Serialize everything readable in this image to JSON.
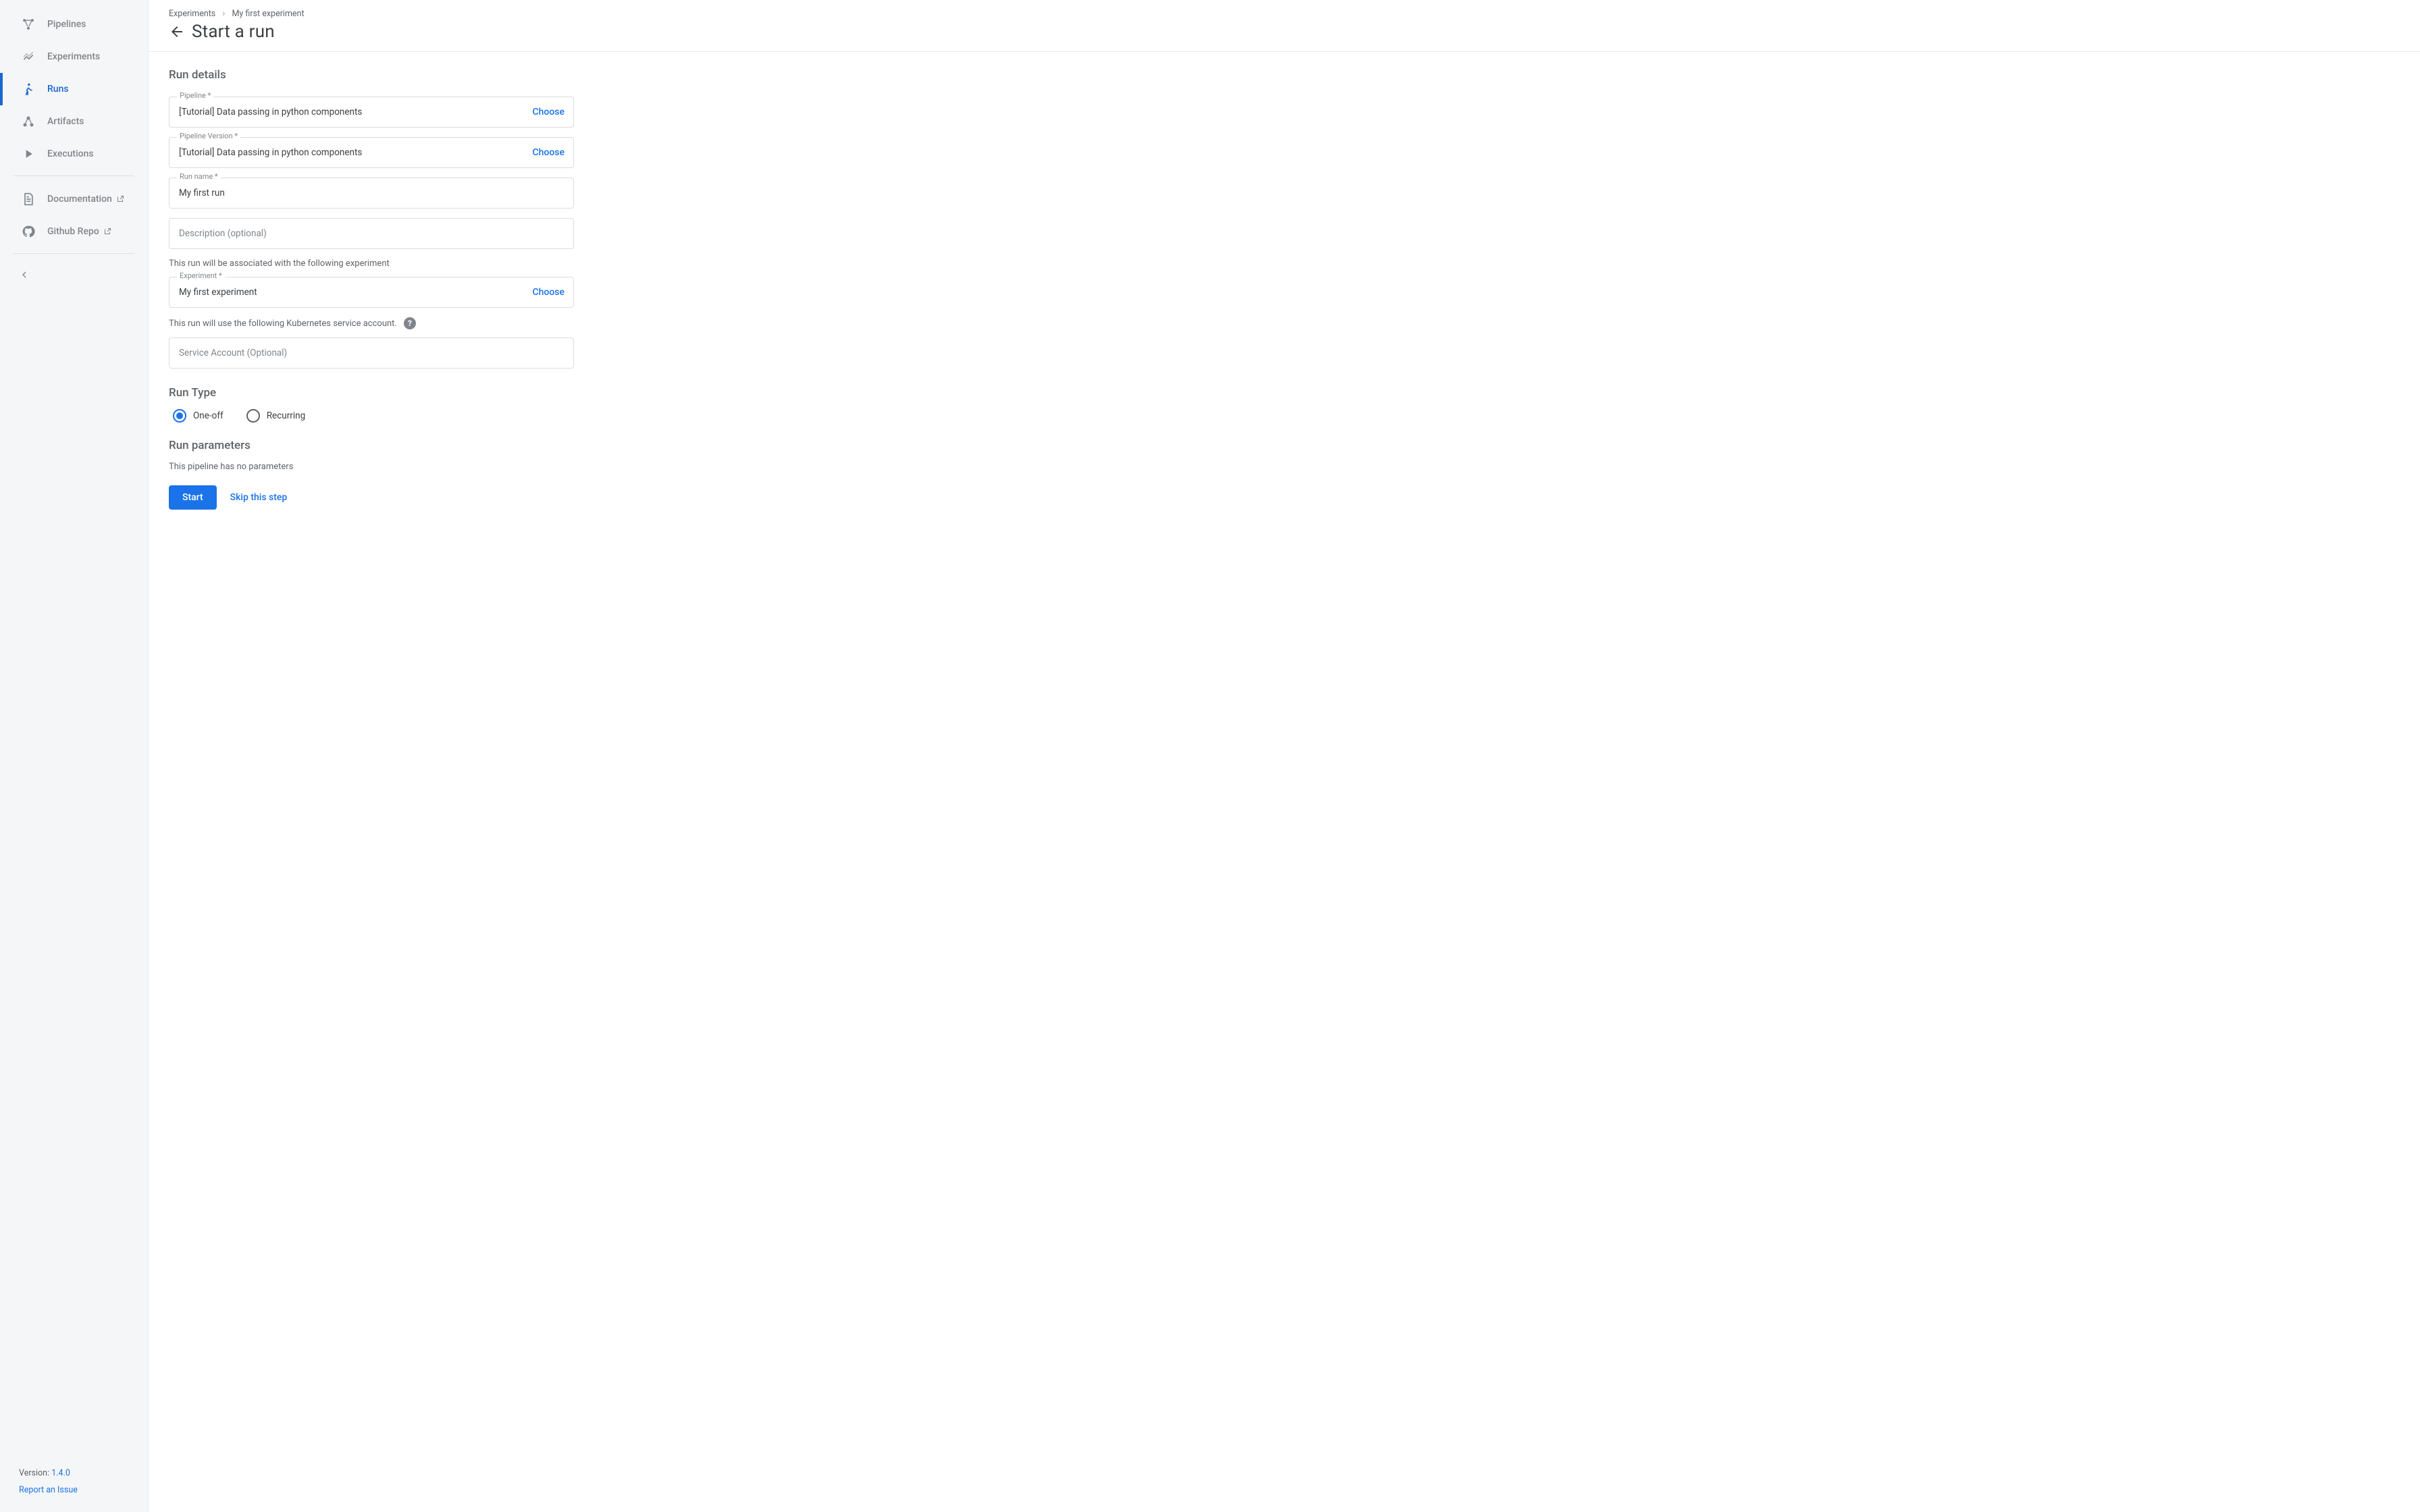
{
  "colors": {
    "accent": "#1a73e8",
    "muted": "#80868b"
  },
  "sidebar": {
    "items": [
      {
        "label": "Pipelines"
      },
      {
        "label": "Experiments"
      },
      {
        "label": "Runs"
      },
      {
        "label": "Artifacts"
      },
      {
        "label": "Executions"
      }
    ],
    "sec_items": [
      {
        "label": "Documentation"
      },
      {
        "label": "Github Repo"
      }
    ],
    "footer": {
      "version_prefix": "Version: ",
      "version": "1.4.0",
      "report": "Report an Issue"
    }
  },
  "breadcrumb": {
    "a": "Experiments",
    "b": "My first experiment"
  },
  "page_title": "Start a run",
  "sections": {
    "run_details": "Run details",
    "run_type": "Run Type",
    "run_params": "Run parameters"
  },
  "fields": {
    "pipeline": {
      "label": "Pipeline *",
      "value": "[Tutorial] Data passing in python components",
      "choose": "Choose"
    },
    "pipeline_version": {
      "label": "Pipeline Version *",
      "value": "[Tutorial] Data passing in python components",
      "choose": "Choose"
    },
    "run_name": {
      "label": "Run name *",
      "value": "My first run"
    },
    "description": {
      "placeholder": "Description (optional)"
    },
    "assoc_text": "This run will be associated with the following experiment",
    "experiment": {
      "label": "Experiment *",
      "value": "My first experiment",
      "choose": "Choose"
    },
    "svc_text": "This run will use the following Kubernetes service account.",
    "service_account": {
      "placeholder": "Service Account (Optional)"
    }
  },
  "run_type": {
    "one_off": "One-off",
    "recurring": "Recurring",
    "selected": "one_off"
  },
  "run_params": {
    "empty": "This pipeline has no parameters"
  },
  "actions": {
    "start": "Start",
    "skip": "Skip this step"
  }
}
